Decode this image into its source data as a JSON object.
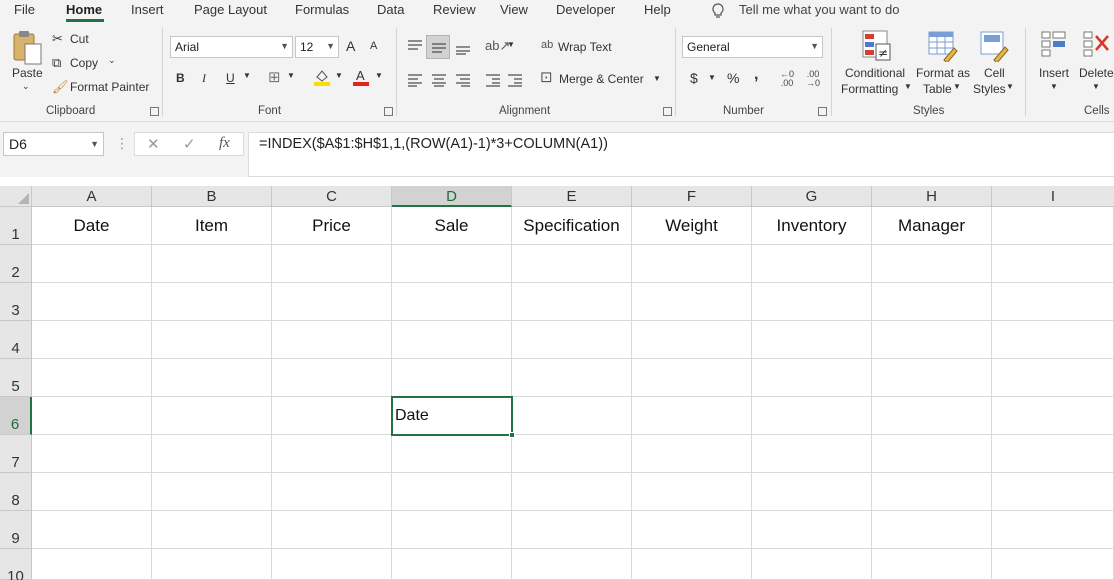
{
  "menu": {
    "items": [
      "File",
      "Home",
      "Insert",
      "Page Layout",
      "Formulas",
      "Data",
      "Review",
      "View",
      "Developer",
      "Help"
    ],
    "active": "Home",
    "tell_me": "Tell me what you want to do"
  },
  "ribbon": {
    "clipboard": {
      "paste": "Paste",
      "cut": "Cut",
      "copy": "Copy",
      "format_painter": "Format Painter",
      "label": "Clipboard"
    },
    "font": {
      "name": "Arial",
      "size": "12",
      "bold": "B",
      "italic": "I",
      "underline": "U",
      "label": "Font",
      "grow": "A",
      "shrink": "A"
    },
    "alignment": {
      "wrap_text": "Wrap Text",
      "merge_center": "Merge & Center",
      "label": "Alignment"
    },
    "number": {
      "format": "General",
      "currency": "$",
      "percent": "%",
      "comma": ",",
      "label": "Number"
    },
    "styles": {
      "conditional": "Conditional",
      "conditional2": "Formatting",
      "format_as": "Format as",
      "format_as2": "Table",
      "cell": "Cell",
      "cell2": "Styles",
      "label": "Styles"
    },
    "cells": {
      "insert": "Insert",
      "delete": "Delete",
      "label": "Cells"
    }
  },
  "formula_bar": {
    "name_box": "D6",
    "fx": "fx",
    "formula": "=INDEX($A$1:$H$1,1,(ROW(A1)-1)*3+COLUMN(A1))"
  },
  "sheet": {
    "columns": [
      "A",
      "B",
      "C",
      "D",
      "E",
      "F",
      "G",
      "H",
      "I"
    ],
    "rows": [
      "1",
      "2",
      "3",
      "4",
      "5",
      "6",
      "7",
      "8",
      "9",
      "10"
    ],
    "row1": [
      "Date",
      "Item",
      "Price",
      "Sale",
      "Specification",
      "Weight",
      "Inventory",
      "Manager"
    ],
    "d6": "Date",
    "selected_cell": "D6"
  },
  "colors": {
    "accent": "#217346",
    "ribbon_bg": "#f3f3f3",
    "header_bg": "#e6e6e6"
  }
}
